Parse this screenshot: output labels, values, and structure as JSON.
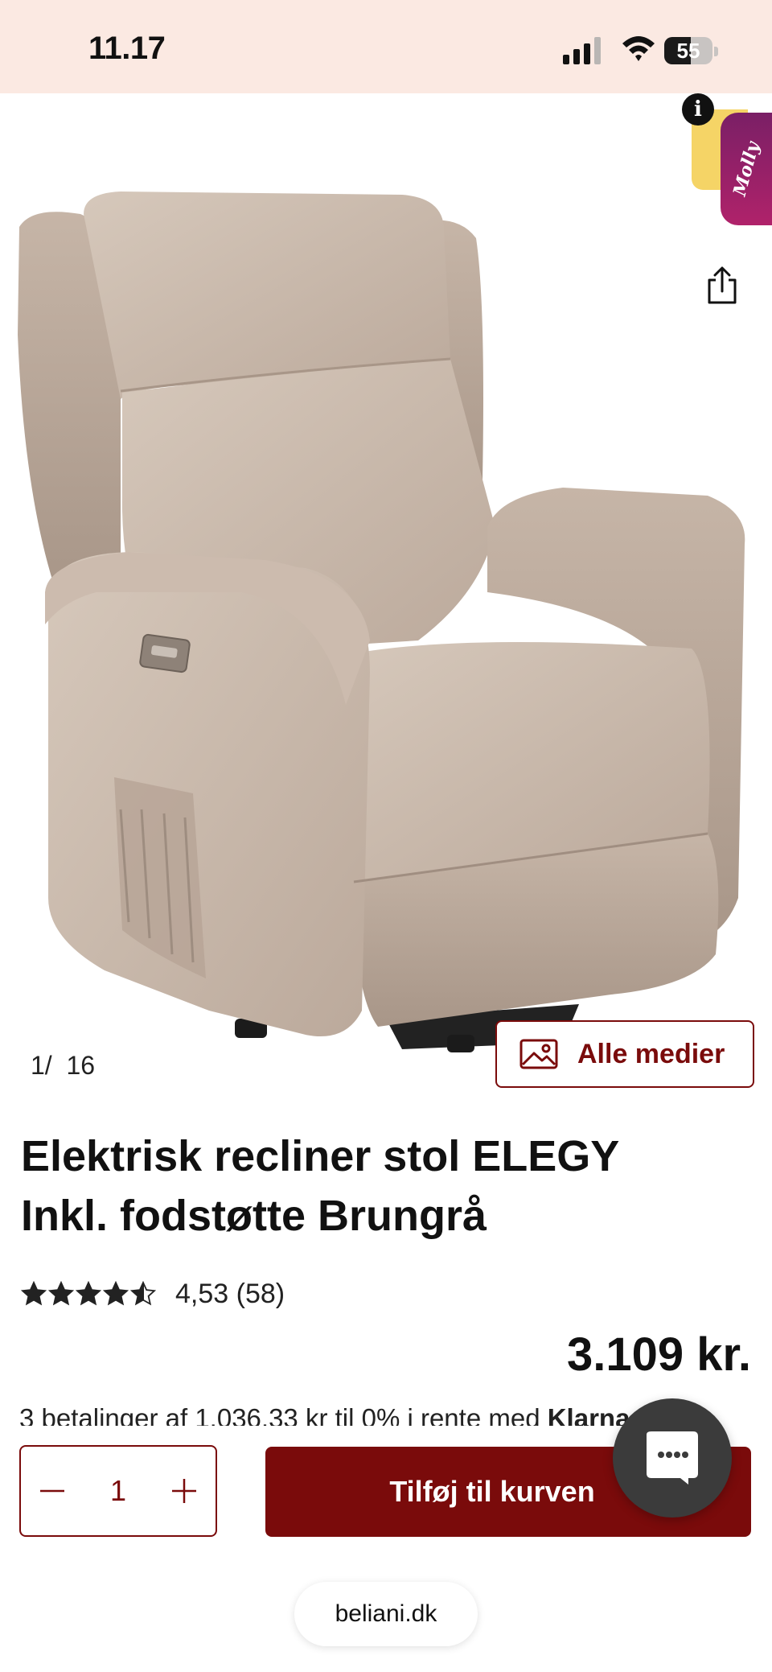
{
  "status_bar": {
    "time": "11.17",
    "battery_level": "55",
    "battery_fraction": 0.55,
    "icons": [
      "signal-icon",
      "wifi-icon",
      "battery-icon"
    ]
  },
  "widget": {
    "info_glyph": "i",
    "assistant_label": "Molly"
  },
  "gallery": {
    "current": "1",
    "total": "16",
    "counter_separator": "/",
    "media_button_label": "Alle medier"
  },
  "product": {
    "title_line1": "Elektrisk recliner stol ELEGY",
    "title_line2": "Inkl. fodstøtte Brungrå",
    "rating_value": 4.53,
    "rating_text": "4,53 (58)",
    "price": "3.109 kr.",
    "installments_text": "3 betalinger af 1.036,33 kr til 0% i rente med ",
    "installments_brand": "Klarna"
  },
  "cart": {
    "quantity": "1",
    "add_to_cart_label": "Tilføj til kurven"
  },
  "browser": {
    "url": "beliani.dk"
  },
  "colors": {
    "brand": "#7a0b0b",
    "status_bar_bg": "#fbe9e2",
    "chair_fabric": "#cdbdb0",
    "chat_button": "#3b3b3b"
  }
}
